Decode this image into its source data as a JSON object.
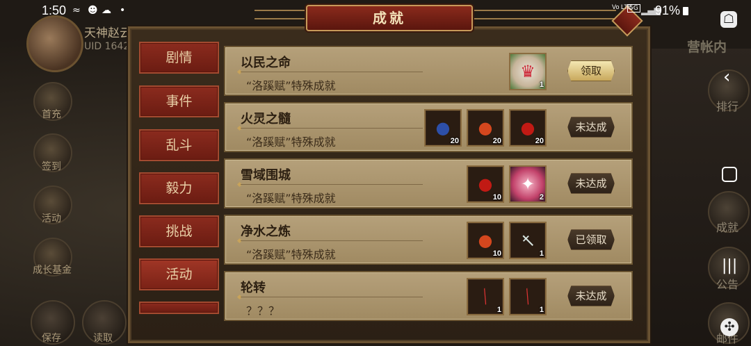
{
  "status_bar": {
    "time": "1:50",
    "network": "Vo LTE",
    "network_type": "5G",
    "battery": "91%"
  },
  "player": {
    "name": "天神赵云",
    "uid": "UID  1642"
  },
  "left_side_buttons": [
    "首充",
    "签到",
    "活动",
    "成长基金"
  ],
  "bottom_buttons": [
    "保存",
    "读取"
  ],
  "right_side": {
    "camp_title": "营帐内",
    "buttons": [
      "排行",
      "成就",
      "公告",
      "邮件"
    ]
  },
  "panel": {
    "title": "成就",
    "tabs": [
      "剧情",
      "事件",
      "乱斗",
      "毅力",
      "挑战",
      "活动"
    ],
    "active_tab": "活动"
  },
  "achievements": [
    {
      "name": "以民之命",
      "description": "“洛蹊赋”特殊成就",
      "rewards": [
        {
          "icon": "lion-dance-icon",
          "qty": "1"
        }
      ],
      "action": "领取",
      "action_type": "claim"
    },
    {
      "name": "火灵之髓",
      "description": "“洛蹊赋”特殊成就",
      "rewards": [
        {
          "icon": "blue-fruit-icon",
          "qty": "20"
        },
        {
          "icon": "red-orange-fruit-icon",
          "qty": "20"
        },
        {
          "icon": "red-fruit-icon",
          "qty": "20"
        }
      ],
      "action": "未达成",
      "action_type": "notyet"
    },
    {
      "name": "雪域围城",
      "description": "“洛蹊赋”特殊成就",
      "rewards": [
        {
          "icon": "red-fruit-icon",
          "qty": "10"
        },
        {
          "icon": "pink-gem-icon",
          "qty": "2"
        }
      ],
      "action": "未达成",
      "action_type": "notyet"
    },
    {
      "name": "净水之炼",
      "description": "“洛蹊赋”特殊成就",
      "rewards": [
        {
          "icon": "red-orange-fruit-icon",
          "qty": "10"
        },
        {
          "icon": "sword-icon",
          "qty": "1"
        }
      ],
      "action": "已领取",
      "action_type": "notyet"
    },
    {
      "name": "轮转",
      "description": "？？？",
      "rewards": [
        {
          "icon": "spear-icon",
          "qty": "1"
        },
        {
          "icon": "spear-icon",
          "qty": "1"
        }
      ],
      "action": "未达成",
      "action_type": "notyet"
    }
  ],
  "colors": {
    "tab_red": "#8b2b1e",
    "row_tan": "#b5a07a",
    "claim_gold": "#e8d59a"
  }
}
